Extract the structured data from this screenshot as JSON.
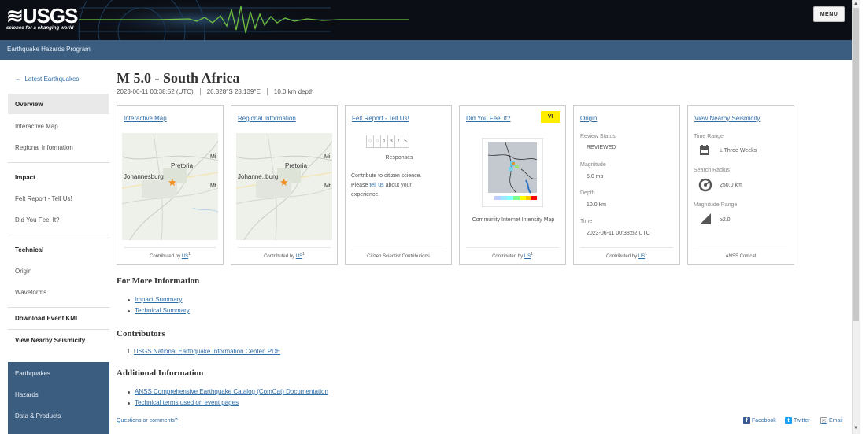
{
  "header": {
    "logo_text": "≋USGS",
    "logo_tagline": "science for a changing world",
    "menu_label": "MENU",
    "program": "Earthquake Hazards Program"
  },
  "sidebar": {
    "back": "Latest Earthquakes",
    "back_icon": "arrow-left-icon",
    "items": {
      "overview": "Overview",
      "interactive_map": "Interactive Map",
      "regional_information": "Regional Information",
      "impact": "Impact",
      "felt_report": "Felt Report - Tell Us!",
      "did_you_feel_it": "Did You Feel It?",
      "technical": "Technical",
      "origin": "Origin",
      "waveforms": "Waveforms",
      "download_kml": "Download Event KML",
      "nearby_seismicity": "View Nearby Seismicity"
    },
    "nav": [
      "Earthquakes",
      "Hazards",
      "Data & Products"
    ]
  },
  "event": {
    "title": "M 5.0 - South Africa",
    "time": "2023-06-11 00:38:52 (UTC)",
    "location": "26.328°S 28.139°E",
    "depth": "10.0 km depth"
  },
  "cards": {
    "interactive_map": {
      "link": "Interactive Map",
      "map_labels": [
        "Pretoria",
        "Johannesburg",
        "Mi",
        "Mt"
      ],
      "footer_prefix": "Contributed by ",
      "footer_link": "US",
      "footer_sup": "1"
    },
    "regional_information": {
      "link": "Regional Information",
      "map_labels": [
        "Pretoria",
        "Johanne..burg",
        "Mi",
        "Mt"
      ],
      "footer_prefix": "Contributed by ",
      "footer_link": "US",
      "footer_sup": "1"
    },
    "felt_report": {
      "link": "Felt Report - Tell Us!",
      "responses_digits": [
        "0",
        "0",
        "1",
        "3",
        "7",
        "5"
      ],
      "responses_label": "Responses",
      "text_1": "Contribute to citizen science.",
      "text_2_prefix": "Please ",
      "text_2_link": "tell us",
      "text_2_suffix": " about your",
      "text_3": "experience.",
      "footer": "Citizen Scientist Contributions"
    },
    "dyfi": {
      "link": "Did You Feel It?",
      "badge": "VI",
      "badge_color": "#ffed00",
      "caption": "Community Internet Intensity Map",
      "footer_prefix": "Contributed by ",
      "footer_link": "US",
      "footer_sup": "1"
    },
    "origin": {
      "link": "Origin",
      "review_status_label": "Review Status",
      "review_status": "REVIEWED",
      "magnitude_label": "Magnitude",
      "magnitude": "5.0 mb",
      "depth_label": "Depth",
      "depth": "10.0 km",
      "time_label": "Time",
      "time": "2023-06-11 00:38:52 UTC",
      "footer_prefix": "Contributed by ",
      "footer_link": "US",
      "footer_sup": "1"
    },
    "nearby": {
      "link": "View Nearby Seismicity",
      "time_range_label": "Time Range",
      "time_range": "± Three Weeks",
      "search_radius_label": "Search Radius",
      "search_radius": "250.0 km",
      "magnitude_range_label": "Magnitude Range",
      "magnitude_range": "≥2.0",
      "footer": "ANSS Comcat"
    }
  },
  "more_info": {
    "heading": "For More Information",
    "links": [
      "Impact Summary",
      "Technical Summary"
    ]
  },
  "contributors": {
    "heading": "Contributors",
    "items": [
      "USGS National Earthquake Information Center, PDE"
    ]
  },
  "additional": {
    "heading": "Additional Information",
    "links": [
      "ANSS Comprehensive Earthquake Catalog (ComCat) Documentation",
      "Technical terms used on event pages"
    ]
  },
  "footer": {
    "questions": "Questions or comments?",
    "facebook": "Facebook",
    "twitter": "Twitter",
    "email": "Email"
  },
  "colors": {
    "header_bg": "#0b0e14",
    "program_bar": "#3b5d80",
    "link": "#2f6da6",
    "seismogram": "#6fbf3f"
  }
}
